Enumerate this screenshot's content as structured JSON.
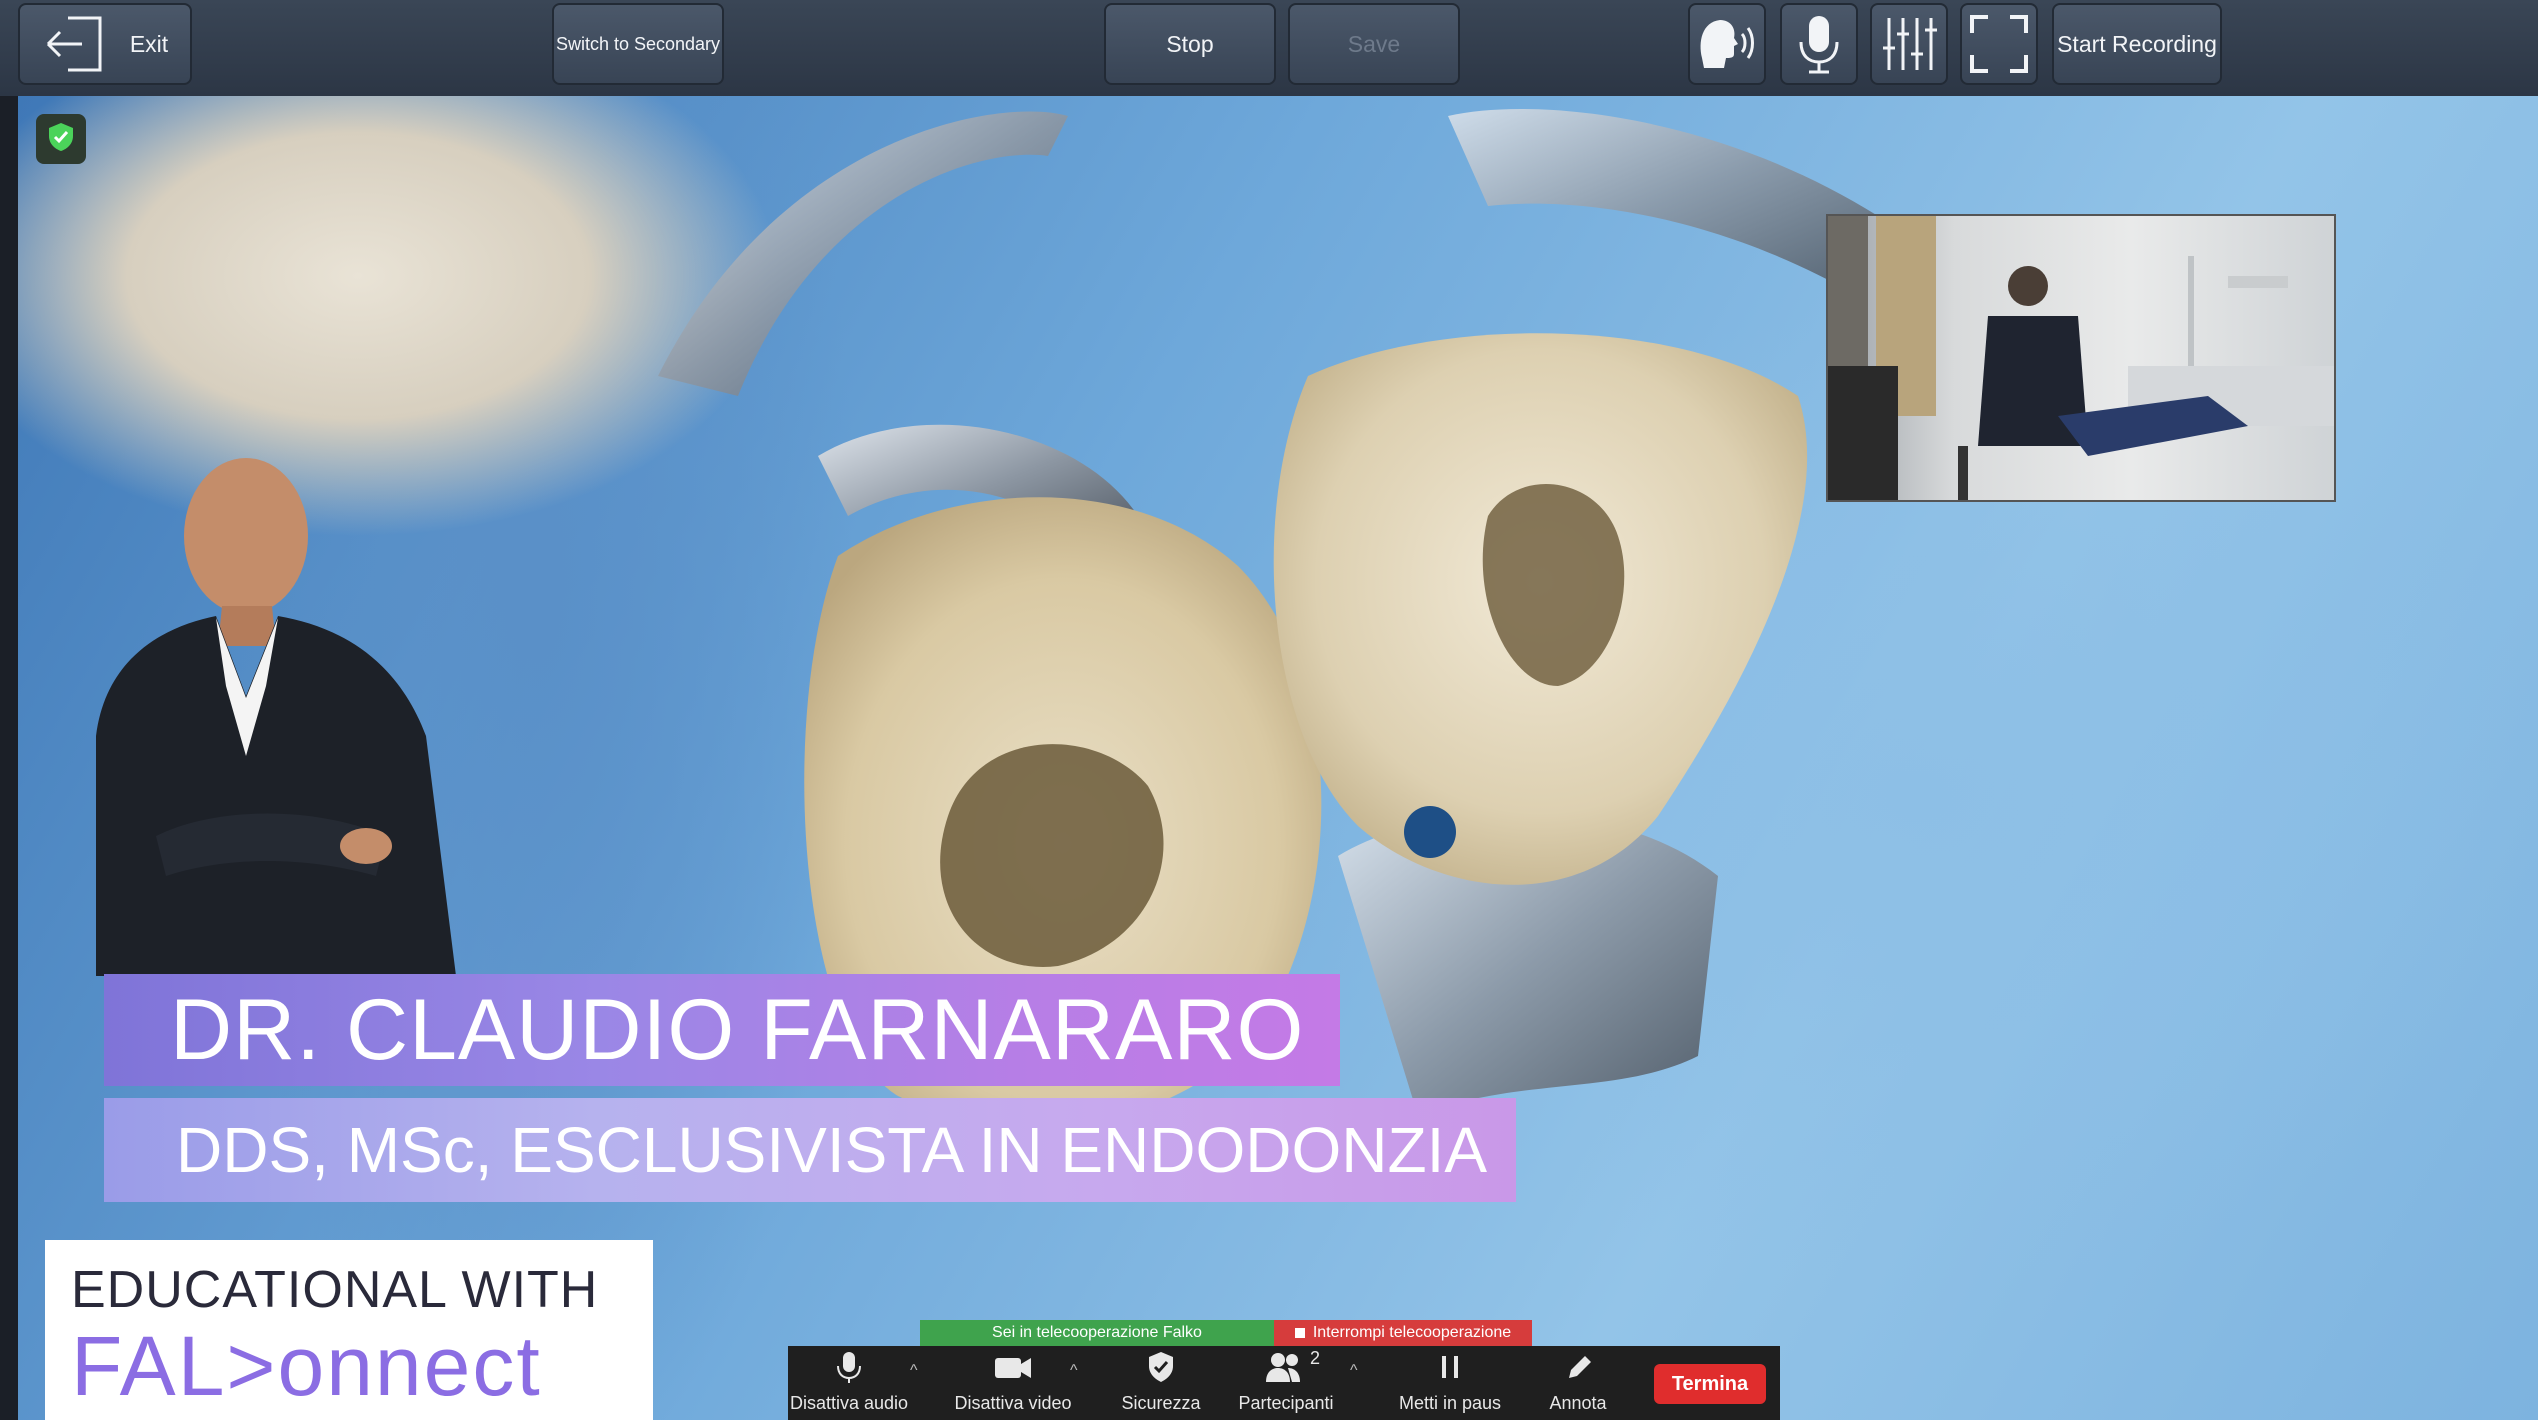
{
  "toolbar": {
    "exit_label": "Exit",
    "switch_label": "Switch to Secondary",
    "stop_label": "Stop",
    "save_label": "Save",
    "start_recording_label": "Start Recording"
  },
  "icons": {
    "exit": "exit-arrow-icon",
    "voice": "voice-speaking-icon",
    "mic": "microphone-icon",
    "mixer": "sliders-icon",
    "fullscreen": "fullscreen-icon",
    "security": "shield-check-icon"
  },
  "overlay": {
    "name": "DR. CLAUDIO FARNARARO",
    "credentials": "DDS, MSc, ESCLUSIVISTA IN ENDODONZIA",
    "logo_line1": "EDUCATIONAL WITH",
    "logo_line2": "FAL>onnect"
  },
  "meeting": {
    "tele_status": "Sei in telecooperazione Falko",
    "stop_tele": "Interrompi telecooperazione",
    "controls": [
      {
        "label": "Disattiva audio"
      },
      {
        "label": "Disattiva video"
      },
      {
        "label": "Sicurezza"
      },
      {
        "label": "Partecipanti",
        "count": "2"
      },
      {
        "label": "Metti in paus"
      },
      {
        "label": "Annota"
      }
    ],
    "end_label": "Termina"
  },
  "colors": {
    "toolbar": "#2c3645",
    "banner_purple": "#9a87e6",
    "end_red": "#e02d2d",
    "tele_green": "#3fa34d"
  }
}
